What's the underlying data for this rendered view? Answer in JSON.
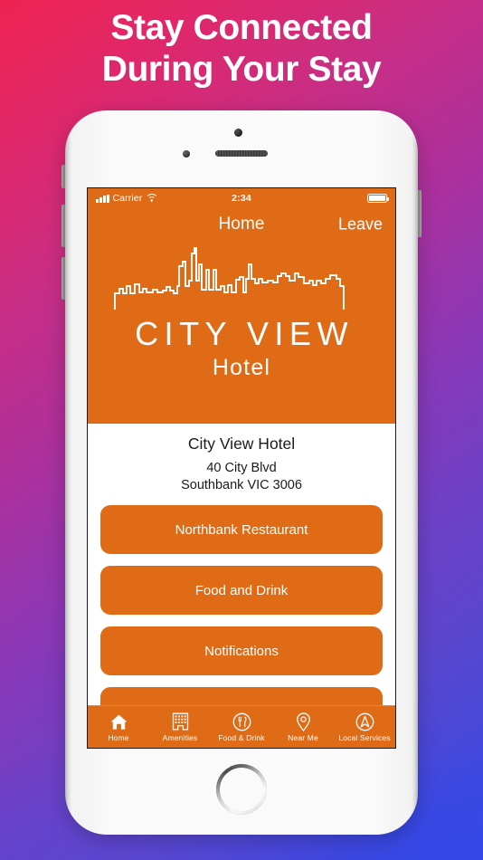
{
  "poster": {
    "headline_line1": "Stay Connected",
    "headline_line2": "During Your Stay",
    "gradient_start": "#ED2350",
    "gradient_mid": "#A832A0",
    "gradient_end": "#3A4BE2"
  },
  "theme": {
    "brand_orange": "#DF6B16",
    "text_dark": "#1B1B1B",
    "on_brand": "#FFFFFF"
  },
  "statusbar": {
    "carrier": "Carrier",
    "time": "2:34",
    "signal_icon": "cellular-signal-icon",
    "wifi_icon": "wifi-icon",
    "battery_icon": "battery-full-icon"
  },
  "navbar": {
    "title": "Home",
    "right_action": "Leave"
  },
  "hero": {
    "skyline_icon": "city-skyline-icon",
    "brand_line1": "CITY VIEW",
    "brand_line2": "Hotel"
  },
  "details": {
    "hotel_name": "City View Hotel",
    "address_line1": "40 City Blvd",
    "address_line2": "Southbank VIC 3006"
  },
  "buttons": [
    {
      "label": "Northbank Restaurant"
    },
    {
      "label": "Food and Drink"
    },
    {
      "label": "Notifications"
    },
    {
      "label": ""
    }
  ],
  "tabbar": {
    "items": [
      {
        "label": "Home",
        "icon": "house-icon",
        "active": true
      },
      {
        "label": "Amenities",
        "icon": "building-icon",
        "active": false
      },
      {
        "label": "Food & Drink",
        "icon": "cutlery-circle-icon",
        "active": false
      },
      {
        "label": "Near Me",
        "icon": "map-pin-icon",
        "active": false
      },
      {
        "label": "Local Services",
        "icon": "compass-icon",
        "active": false
      }
    ]
  },
  "device": {
    "sensor_icon": "proximity-sensor-dot",
    "camera_icon": "front-camera-dot",
    "speaker_icon": "earpiece-speaker-grille",
    "home_button_icon": "home-button"
  }
}
